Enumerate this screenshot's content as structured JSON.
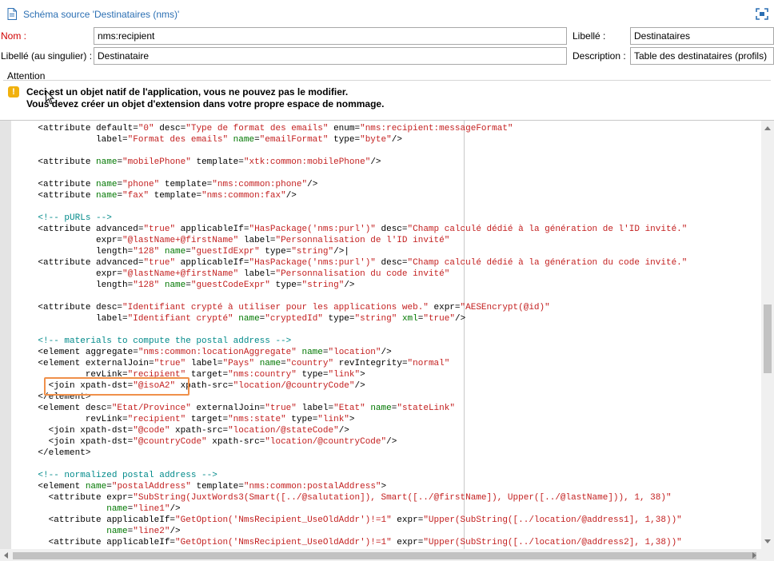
{
  "header": {
    "title": "Schéma source 'Destinataires (nms)'",
    "title_icon": "document-icon",
    "fit_icon": "fit-screen-icon"
  },
  "form": {
    "name_label": "Nom :",
    "name_value": "nms:recipient",
    "label_label": "Libellé :",
    "label_value": "Destinataires",
    "singular_label": "Libellé (au singulier) :",
    "singular_value": "Destinataire",
    "description_label": "Description :",
    "description_value": "Table des destinataires (profils)"
  },
  "attention": {
    "title": "Attention",
    "icon": "warning-icon",
    "line1": "Ceci est un objet natif de l'application, vous ne pouvez pas le modifier.",
    "line2": "Vous devez créer un objet d'extension dans votre propre espace de nommage.",
    "accent_color": "#f1b10e"
  },
  "editor": {
    "highlight_color": "#f0904a",
    "lines": [
      [
        [
          "t",
          "    <attribute default="
        ],
        [
          "s",
          "\"0\""
        ],
        [
          "t",
          " desc="
        ],
        [
          "s",
          "\"Type de format des emails\""
        ],
        [
          "t",
          " enum="
        ],
        [
          "s",
          "\"nms:recipient:messageFormat\""
        ]
      ],
      [
        [
          "t",
          "               label="
        ],
        [
          "s",
          "\"Format des emails\""
        ],
        [
          "t",
          " "
        ],
        [
          "a",
          "name"
        ],
        [
          "t",
          "="
        ],
        [
          "s",
          "\"emailFormat\""
        ],
        [
          "t",
          " type="
        ],
        [
          "s",
          "\"byte\""
        ],
        [
          "t",
          "/>"
        ]
      ],
      [
        [
          "t",
          ""
        ]
      ],
      [
        [
          "t",
          "    <attribute "
        ],
        [
          "a",
          "name"
        ],
        [
          "t",
          "="
        ],
        [
          "s",
          "\"mobilePhone\""
        ],
        [
          "t",
          " template="
        ],
        [
          "s",
          "\"xtk:common:mobilePhone\""
        ],
        [
          "t",
          "/>"
        ]
      ],
      [
        [
          "t",
          ""
        ]
      ],
      [
        [
          "t",
          "    <attribute "
        ],
        [
          "a",
          "name"
        ],
        [
          "t",
          "="
        ],
        [
          "s",
          "\"phone\""
        ],
        [
          "t",
          " template="
        ],
        [
          "s",
          "\"nms:common:phone\""
        ],
        [
          "t",
          "/>"
        ]
      ],
      [
        [
          "t",
          "    <attribute "
        ],
        [
          "a",
          "name"
        ],
        [
          "t",
          "="
        ],
        [
          "s",
          "\"fax\""
        ],
        [
          "t",
          " template="
        ],
        [
          "s",
          "\"nms:common:fax\""
        ],
        [
          "t",
          "/>"
        ]
      ],
      [
        [
          "t",
          ""
        ]
      ],
      [
        [
          "c",
          "    <!-- pURLs -->"
        ]
      ],
      [
        [
          "t",
          "    <attribute advanced="
        ],
        [
          "s",
          "\"true\""
        ],
        [
          "t",
          " applicableIf="
        ],
        [
          "s",
          "\"HasPackage('nms:purl')\""
        ],
        [
          "t",
          " desc="
        ],
        [
          "s",
          "\"Champ calculé dédié à la génération de l'ID invité.\""
        ]
      ],
      [
        [
          "t",
          "               expr="
        ],
        [
          "s",
          "\"@lastName+@firstName\""
        ],
        [
          "t",
          " label="
        ],
        [
          "s",
          "\"Personnalisation de l'ID invité\""
        ]
      ],
      [
        [
          "t",
          "               length="
        ],
        [
          "s",
          "\"128\""
        ],
        [
          "t",
          " "
        ],
        [
          "a",
          "name"
        ],
        [
          "t",
          "="
        ],
        [
          "s",
          "\"guestIdExpr\""
        ],
        [
          "t",
          " type="
        ],
        [
          "s",
          "\"string\""
        ],
        [
          "t",
          "/>|"
        ]
      ],
      [
        [
          "t",
          "    <attribute advanced="
        ],
        [
          "s",
          "\"true\""
        ],
        [
          "t",
          " applicableIf="
        ],
        [
          "s",
          "\"HasPackage('nms:purl')\""
        ],
        [
          "t",
          " desc="
        ],
        [
          "s",
          "\"Champ calculé dédié à la génération du code invité.\""
        ]
      ],
      [
        [
          "t",
          "               expr="
        ],
        [
          "s",
          "\"@lastName+@firstName\""
        ],
        [
          "t",
          " label="
        ],
        [
          "s",
          "\"Personnalisation du code invité\""
        ]
      ],
      [
        [
          "t",
          "               length="
        ],
        [
          "s",
          "\"128\""
        ],
        [
          "t",
          " "
        ],
        [
          "a",
          "name"
        ],
        [
          "t",
          "="
        ],
        [
          "s",
          "\"guestCodeExpr\""
        ],
        [
          "t",
          " type="
        ],
        [
          "s",
          "\"string\""
        ],
        [
          "t",
          "/>"
        ]
      ],
      [
        [
          "t",
          ""
        ]
      ],
      [
        [
          "t",
          "    <attribute desc="
        ],
        [
          "s",
          "\"Identifiant crypté à utiliser pour les applications web.\""
        ],
        [
          "t",
          " expr="
        ],
        [
          "s",
          "\"AESEncrypt(@id)\""
        ]
      ],
      [
        [
          "t",
          "               label="
        ],
        [
          "s",
          "\"Identifiant crypté\""
        ],
        [
          "t",
          " "
        ],
        [
          "a",
          "name"
        ],
        [
          "t",
          "="
        ],
        [
          "s",
          "\"cryptedId\""
        ],
        [
          "t",
          " type="
        ],
        [
          "s",
          "\"string\""
        ],
        [
          "t",
          " "
        ],
        [
          "a",
          "xml"
        ],
        [
          "t",
          "="
        ],
        [
          "s",
          "\"true\""
        ],
        [
          "t",
          "/>"
        ]
      ],
      [
        [
          "t",
          ""
        ]
      ],
      [
        [
          "c",
          "    <!-- materials to compute the postal address -->"
        ]
      ],
      [
        [
          "t",
          "    <element aggregate="
        ],
        [
          "s",
          "\"nms:common:locationAggregate\""
        ],
        [
          "t",
          " "
        ],
        [
          "a",
          "name"
        ],
        [
          "t",
          "="
        ],
        [
          "s",
          "\"location\""
        ],
        [
          "t",
          "/>"
        ]
      ],
      [
        [
          "t",
          "    <element externalJoin="
        ],
        [
          "s",
          "\"true\""
        ],
        [
          "t",
          " label="
        ],
        [
          "s",
          "\"Pays\""
        ],
        [
          "t",
          " "
        ],
        [
          "a",
          "name"
        ],
        [
          "t",
          "="
        ],
        [
          "s",
          "\"country\""
        ],
        [
          "t",
          " revIntegrity="
        ],
        [
          "s",
          "\"normal\""
        ]
      ],
      [
        [
          "t",
          "             revLink="
        ],
        [
          "s",
          "\"recipient\""
        ],
        [
          "t",
          " target="
        ],
        [
          "s",
          "\"nms:country\""
        ],
        [
          "t",
          " type="
        ],
        [
          "s",
          "\"link\""
        ],
        [
          "t",
          ">"
        ]
      ],
      [
        [
          "t",
          "      <join xpath-dst="
        ],
        [
          "s",
          "\"@isoA2\""
        ],
        [
          "t",
          " xpath-src="
        ],
        [
          "s",
          "\"location/@countryCode\""
        ],
        [
          "t",
          "/>"
        ]
      ],
      [
        [
          "t",
          "    </element>"
        ]
      ],
      [
        [
          "t",
          "    <element desc="
        ],
        [
          "s",
          "\"Etat/Province\""
        ],
        [
          "t",
          " externalJoin="
        ],
        [
          "s",
          "\"true\""
        ],
        [
          "t",
          " label="
        ],
        [
          "s",
          "\"Etat\""
        ],
        [
          "t",
          " "
        ],
        [
          "a",
          "name"
        ],
        [
          "t",
          "="
        ],
        [
          "s",
          "\"stateLink\""
        ]
      ],
      [
        [
          "t",
          "             revLink="
        ],
        [
          "s",
          "\"recipient\""
        ],
        [
          "t",
          " target="
        ],
        [
          "s",
          "\"nms:state\""
        ],
        [
          "t",
          " type="
        ],
        [
          "s",
          "\"link\""
        ],
        [
          "t",
          ">"
        ]
      ],
      [
        [
          "t",
          "      <join xpath-dst="
        ],
        [
          "s",
          "\"@code\""
        ],
        [
          "t",
          " xpath-src="
        ],
        [
          "s",
          "\"location/@stateCode\""
        ],
        [
          "t",
          "/>"
        ]
      ],
      [
        [
          "t",
          "      <join xpath-dst="
        ],
        [
          "s",
          "\"@countryCode\""
        ],
        [
          "t",
          " xpath-src="
        ],
        [
          "s",
          "\"location/@countryCode\""
        ],
        [
          "t",
          "/>"
        ]
      ],
      [
        [
          "t",
          "    </element>"
        ]
      ],
      [
        [
          "t",
          ""
        ]
      ],
      [
        [
          "c",
          "    <!-- normalized postal address -->"
        ]
      ],
      [
        [
          "t",
          "    <element "
        ],
        [
          "a",
          "name"
        ],
        [
          "t",
          "="
        ],
        [
          "s",
          "\"postalAddress\""
        ],
        [
          "t",
          " template="
        ],
        [
          "s",
          "\"nms:common:postalAddress\""
        ],
        [
          "t",
          ">"
        ]
      ],
      [
        [
          "t",
          "      <attribute expr="
        ],
        [
          "s",
          "\"SubString(JuxtWords3(Smart([../@salutation]), Smart([../@firstName]), Upper([../@lastName])), 1, 38)\""
        ]
      ],
      [
        [
          "t",
          "                 "
        ],
        [
          "a",
          "name"
        ],
        [
          "t",
          "="
        ],
        [
          "s",
          "\"line1\""
        ],
        [
          "t",
          "/>"
        ]
      ],
      [
        [
          "t",
          "      <attribute applicableIf="
        ],
        [
          "s",
          "\"GetOption('NmsRecipient_UseOldAddr')!=1\""
        ],
        [
          "t",
          " expr="
        ],
        [
          "s",
          "\"Upper(SubString([../location/@address1], 1,38))\""
        ]
      ],
      [
        [
          "t",
          "                 "
        ],
        [
          "a",
          "name"
        ],
        [
          "t",
          "="
        ],
        [
          "s",
          "\"line2\""
        ],
        [
          "t",
          "/>"
        ]
      ],
      [
        [
          "t",
          "      <attribute applicableIf="
        ],
        [
          "s",
          "\"GetOption('NmsRecipient_UseOldAddr')!=1\""
        ],
        [
          "t",
          " expr="
        ],
        [
          "s",
          "\"Upper(SubString([../location/@address2], 1,38))\""
        ]
      ]
    ]
  }
}
